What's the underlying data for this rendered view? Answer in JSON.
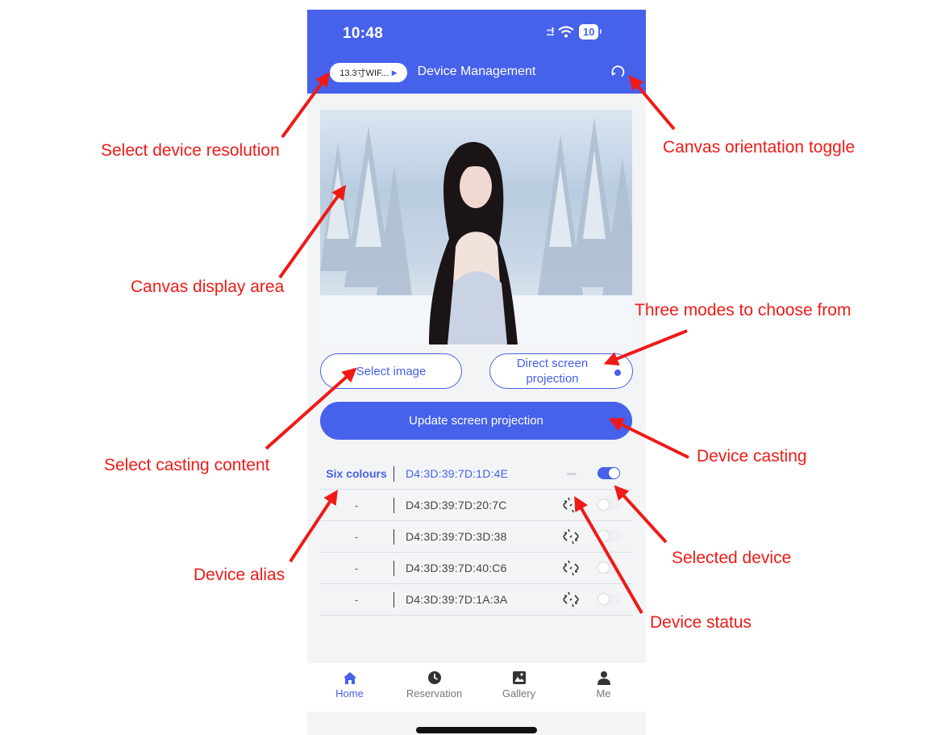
{
  "status_bar": {
    "time": "10:48",
    "signal": "::!",
    "battery": "10"
  },
  "header": {
    "resolution": "13.3寸WIF...",
    "title": "Device Management"
  },
  "buttons": {
    "select_image": "Select image",
    "mode_line1": "Direct screen",
    "mode_line2": "projection",
    "update": "Update screen projection"
  },
  "devices": [
    {
      "alias": "Six colours",
      "mac": "D4:3D:39:7D:1D:4E",
      "status": "idle",
      "selected": true
    },
    {
      "alias": "-",
      "mac": "D4:3D:39:7D:20:7C",
      "status": "disconnected",
      "selected": false
    },
    {
      "alias": "-",
      "mac": "D4:3D:39:7D:3D:38",
      "status": "disconnected",
      "selected": false
    },
    {
      "alias": "-",
      "mac": "D4:3D:39:7D:40:C6",
      "status": "disconnected",
      "selected": false
    },
    {
      "alias": "-",
      "mac": "D4:3D:39:7D:1A:3A",
      "status": "disconnected",
      "selected": false
    }
  ],
  "tabs": [
    {
      "label": "Home",
      "icon": "home-icon",
      "active": true
    },
    {
      "label": "Reservation",
      "icon": "clock-icon",
      "active": false
    },
    {
      "label": "Gallery",
      "icon": "image-icon",
      "active": false
    },
    {
      "label": "Me",
      "icon": "person-icon",
      "active": false
    }
  ],
  "annotations": {
    "resolution": "Select device resolution",
    "orientation": "Canvas orientation toggle",
    "canvas": "Canvas display area",
    "modes": "Three modes to choose from",
    "content": "Select casting content",
    "casting": "Device casting",
    "alias": "Device alias",
    "selected": "Selected device",
    "status": "Device status"
  },
  "colors": {
    "accent": "#4661ea",
    "annotation": "#ef1a17"
  }
}
